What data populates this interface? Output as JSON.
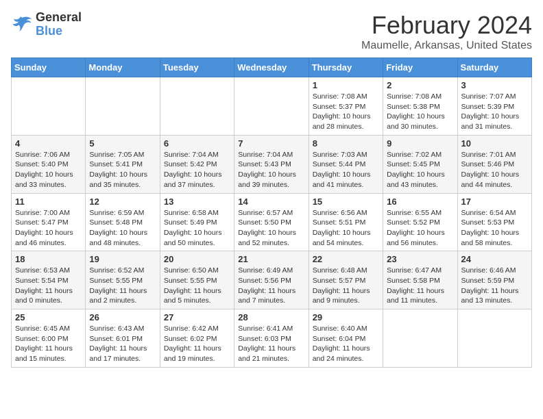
{
  "logo": {
    "line1": "General",
    "line2": "Blue"
  },
  "title": "February 2024",
  "subtitle": "Maumelle, Arkansas, United States",
  "days_of_week": [
    "Sunday",
    "Monday",
    "Tuesday",
    "Wednesday",
    "Thursday",
    "Friday",
    "Saturday"
  ],
  "weeks": [
    [
      {
        "day": "",
        "info": ""
      },
      {
        "day": "",
        "info": ""
      },
      {
        "day": "",
        "info": ""
      },
      {
        "day": "",
        "info": ""
      },
      {
        "day": "1",
        "info": "Sunrise: 7:08 AM\nSunset: 5:37 PM\nDaylight: 10 hours\nand 28 minutes."
      },
      {
        "day": "2",
        "info": "Sunrise: 7:08 AM\nSunset: 5:38 PM\nDaylight: 10 hours\nand 30 minutes."
      },
      {
        "day": "3",
        "info": "Sunrise: 7:07 AM\nSunset: 5:39 PM\nDaylight: 10 hours\nand 31 minutes."
      }
    ],
    [
      {
        "day": "4",
        "info": "Sunrise: 7:06 AM\nSunset: 5:40 PM\nDaylight: 10 hours\nand 33 minutes."
      },
      {
        "day": "5",
        "info": "Sunrise: 7:05 AM\nSunset: 5:41 PM\nDaylight: 10 hours\nand 35 minutes."
      },
      {
        "day": "6",
        "info": "Sunrise: 7:04 AM\nSunset: 5:42 PM\nDaylight: 10 hours\nand 37 minutes."
      },
      {
        "day": "7",
        "info": "Sunrise: 7:04 AM\nSunset: 5:43 PM\nDaylight: 10 hours\nand 39 minutes."
      },
      {
        "day": "8",
        "info": "Sunrise: 7:03 AM\nSunset: 5:44 PM\nDaylight: 10 hours\nand 41 minutes."
      },
      {
        "day": "9",
        "info": "Sunrise: 7:02 AM\nSunset: 5:45 PM\nDaylight: 10 hours\nand 43 minutes."
      },
      {
        "day": "10",
        "info": "Sunrise: 7:01 AM\nSunset: 5:46 PM\nDaylight: 10 hours\nand 44 minutes."
      }
    ],
    [
      {
        "day": "11",
        "info": "Sunrise: 7:00 AM\nSunset: 5:47 PM\nDaylight: 10 hours\nand 46 minutes."
      },
      {
        "day": "12",
        "info": "Sunrise: 6:59 AM\nSunset: 5:48 PM\nDaylight: 10 hours\nand 48 minutes."
      },
      {
        "day": "13",
        "info": "Sunrise: 6:58 AM\nSunset: 5:49 PM\nDaylight: 10 hours\nand 50 minutes."
      },
      {
        "day": "14",
        "info": "Sunrise: 6:57 AM\nSunset: 5:50 PM\nDaylight: 10 hours\nand 52 minutes."
      },
      {
        "day": "15",
        "info": "Sunrise: 6:56 AM\nSunset: 5:51 PM\nDaylight: 10 hours\nand 54 minutes."
      },
      {
        "day": "16",
        "info": "Sunrise: 6:55 AM\nSunset: 5:52 PM\nDaylight: 10 hours\nand 56 minutes."
      },
      {
        "day": "17",
        "info": "Sunrise: 6:54 AM\nSunset: 5:53 PM\nDaylight: 10 hours\nand 58 minutes."
      }
    ],
    [
      {
        "day": "18",
        "info": "Sunrise: 6:53 AM\nSunset: 5:54 PM\nDaylight: 11 hours\nand 0 minutes."
      },
      {
        "day": "19",
        "info": "Sunrise: 6:52 AM\nSunset: 5:55 PM\nDaylight: 11 hours\nand 2 minutes."
      },
      {
        "day": "20",
        "info": "Sunrise: 6:50 AM\nSunset: 5:55 PM\nDaylight: 11 hours\nand 5 minutes."
      },
      {
        "day": "21",
        "info": "Sunrise: 6:49 AM\nSunset: 5:56 PM\nDaylight: 11 hours\nand 7 minutes."
      },
      {
        "day": "22",
        "info": "Sunrise: 6:48 AM\nSunset: 5:57 PM\nDaylight: 11 hours\nand 9 minutes."
      },
      {
        "day": "23",
        "info": "Sunrise: 6:47 AM\nSunset: 5:58 PM\nDaylight: 11 hours\nand 11 minutes."
      },
      {
        "day": "24",
        "info": "Sunrise: 6:46 AM\nSunset: 5:59 PM\nDaylight: 11 hours\nand 13 minutes."
      }
    ],
    [
      {
        "day": "25",
        "info": "Sunrise: 6:45 AM\nSunset: 6:00 PM\nDaylight: 11 hours\nand 15 minutes."
      },
      {
        "day": "26",
        "info": "Sunrise: 6:43 AM\nSunset: 6:01 PM\nDaylight: 11 hours\nand 17 minutes."
      },
      {
        "day": "27",
        "info": "Sunrise: 6:42 AM\nSunset: 6:02 PM\nDaylight: 11 hours\nand 19 minutes."
      },
      {
        "day": "28",
        "info": "Sunrise: 6:41 AM\nSunset: 6:03 PM\nDaylight: 11 hours\nand 21 minutes."
      },
      {
        "day": "29",
        "info": "Sunrise: 6:40 AM\nSunset: 6:04 PM\nDaylight: 11 hours\nand 24 minutes."
      },
      {
        "day": "",
        "info": ""
      },
      {
        "day": "",
        "info": ""
      }
    ]
  ]
}
